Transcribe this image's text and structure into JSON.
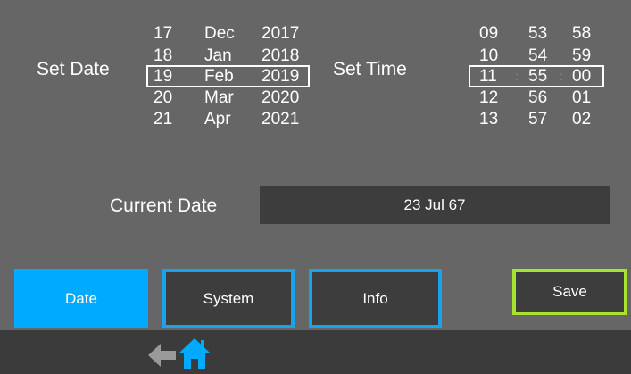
{
  "date_picker": {
    "label": "Set Date",
    "days": [
      "17",
      "18",
      "19",
      "20",
      "21"
    ],
    "months": [
      "Dec",
      "Jan",
      "Feb",
      "Mar",
      "Apr"
    ],
    "years": [
      "2017",
      "2018",
      "2019",
      "2020",
      "2021"
    ]
  },
  "time_picker": {
    "label": "Set Time",
    "hours": [
      "09",
      "10",
      "11",
      "12",
      "13"
    ],
    "minutes": [
      "53",
      "54",
      "55",
      "56",
      "57"
    ],
    "seconds": [
      "58",
      "59",
      "00",
      "01",
      "02"
    ],
    "separator": ":"
  },
  "current_date": {
    "label": "Current Date",
    "value": "23 Jul 67"
  },
  "tabs": [
    {
      "label": "Date"
    },
    {
      "label": "System"
    },
    {
      "label": "Info"
    }
  ],
  "save_label": "Save",
  "nav": {
    "back_icon": "arrow-left-icon",
    "home_icon": "home-icon"
  },
  "colors": {
    "background": "#666666",
    "field_bg": "#3d3d3d",
    "active_tab": "#00aaff",
    "tab_border": "#1aa3e8",
    "save_border": "#a6e22e",
    "bottom_bar": "#3b3b3b",
    "icon_blue": "#00aaff",
    "icon_gray": "#9a9a9a"
  }
}
